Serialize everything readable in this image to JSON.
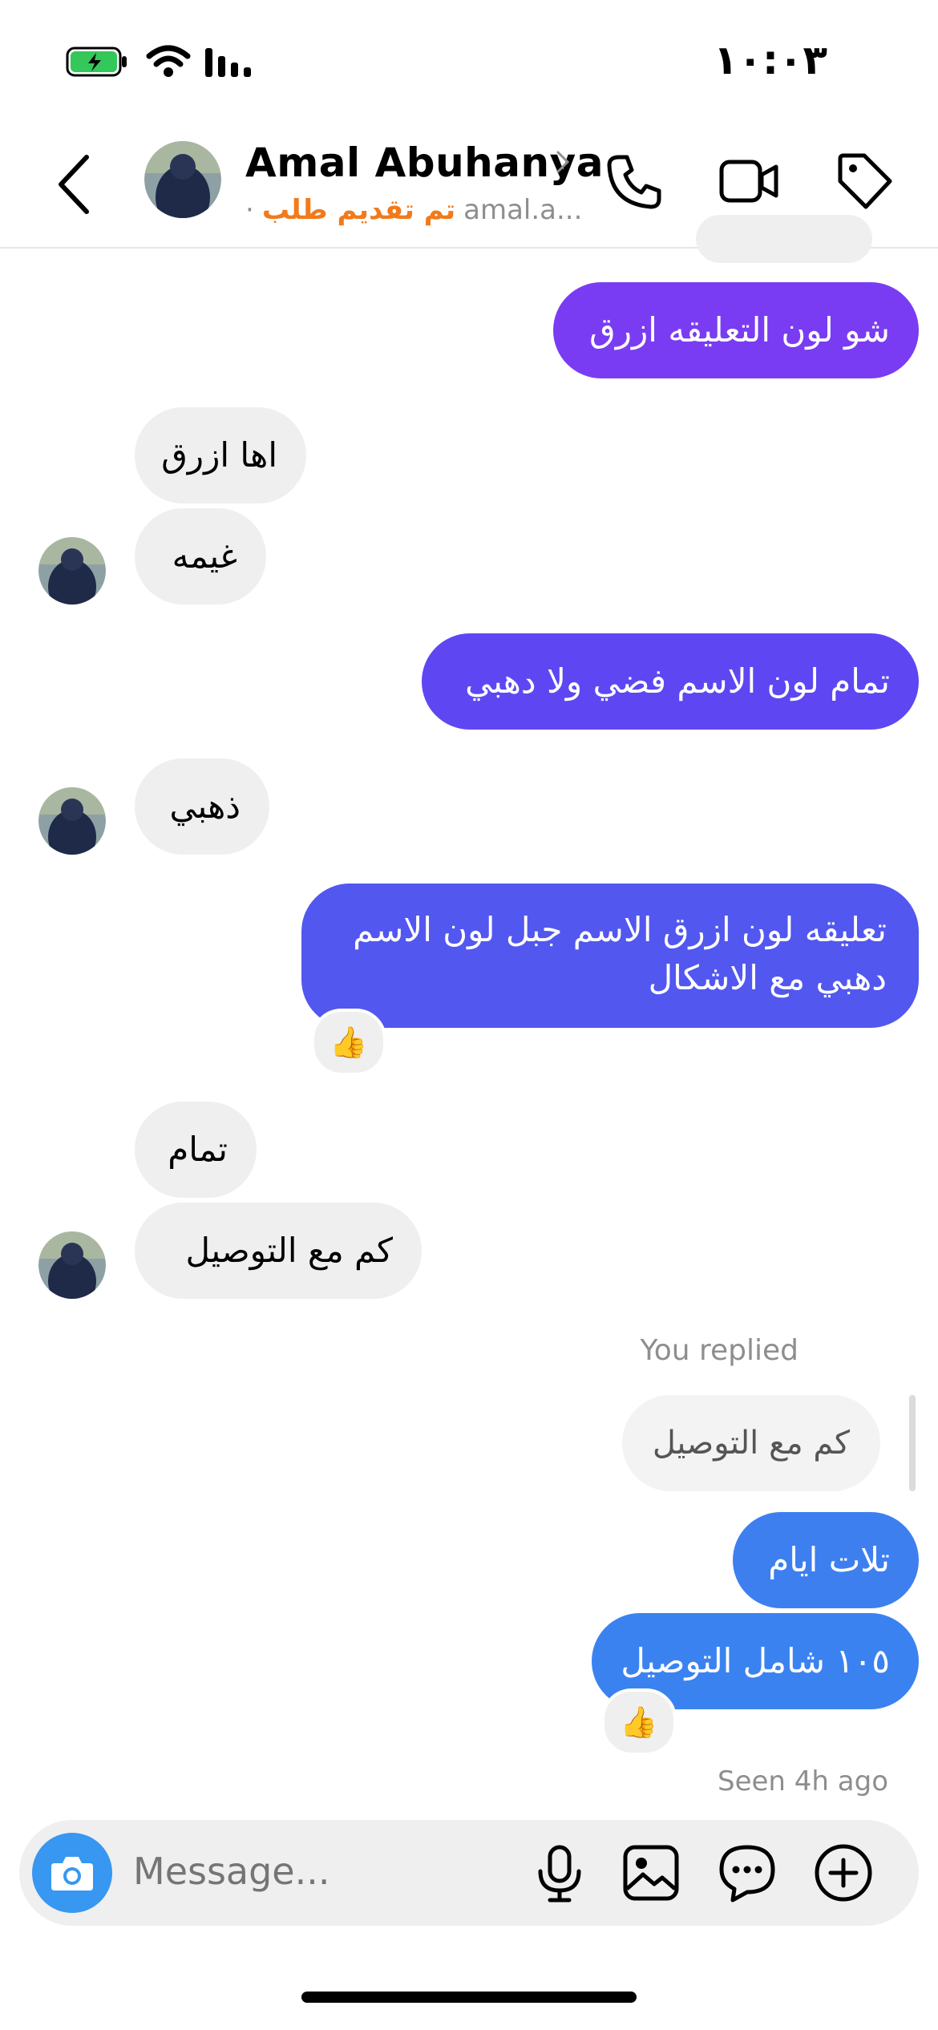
{
  "status_bar": {
    "time": "١٠:٠٣"
  },
  "header": {
    "name": "Amal Abuhanya",
    "username": "amal.a...",
    "status": "تم تقديم طلب",
    "dot": "·"
  },
  "messages": {
    "m1": "شو لون التعليقه ازرق",
    "m2": "اها ازرق",
    "m3": "غيمه",
    "m4": "تمام لون الاسم فضي ولا دهبي",
    "m5": "ذهبي",
    "m6": "تعليقه لون ازرق الاسم جبل لون الاسم دهبي مع الاشكال",
    "m7": "تمام",
    "m8": "كم مع التوصيل",
    "reply_label": "You replied",
    "quoted": "كم مع التوصيل",
    "m9": "تلات ايام",
    "m10": "١٠٥ شامل التوصيل",
    "reaction": "👍",
    "seen": "Seen 4h ago"
  },
  "composer": {
    "placeholder": "Message..."
  },
  "colors": {
    "bubble_purple": "#7a3cf2",
    "bubble_violet": "#5b50f0",
    "bubble_blue": "#3b82f1",
    "status_orange": "#f27a1a",
    "camera_blue": "#3897f0"
  },
  "icons": [
    "battery-icon",
    "wifi-icon",
    "signal-icon",
    "back-chevron-icon",
    "phone-icon",
    "video-icon",
    "tag-icon",
    "camera-icon",
    "microphone-icon",
    "gallery-icon",
    "sticker-icon",
    "plus-icon"
  ]
}
